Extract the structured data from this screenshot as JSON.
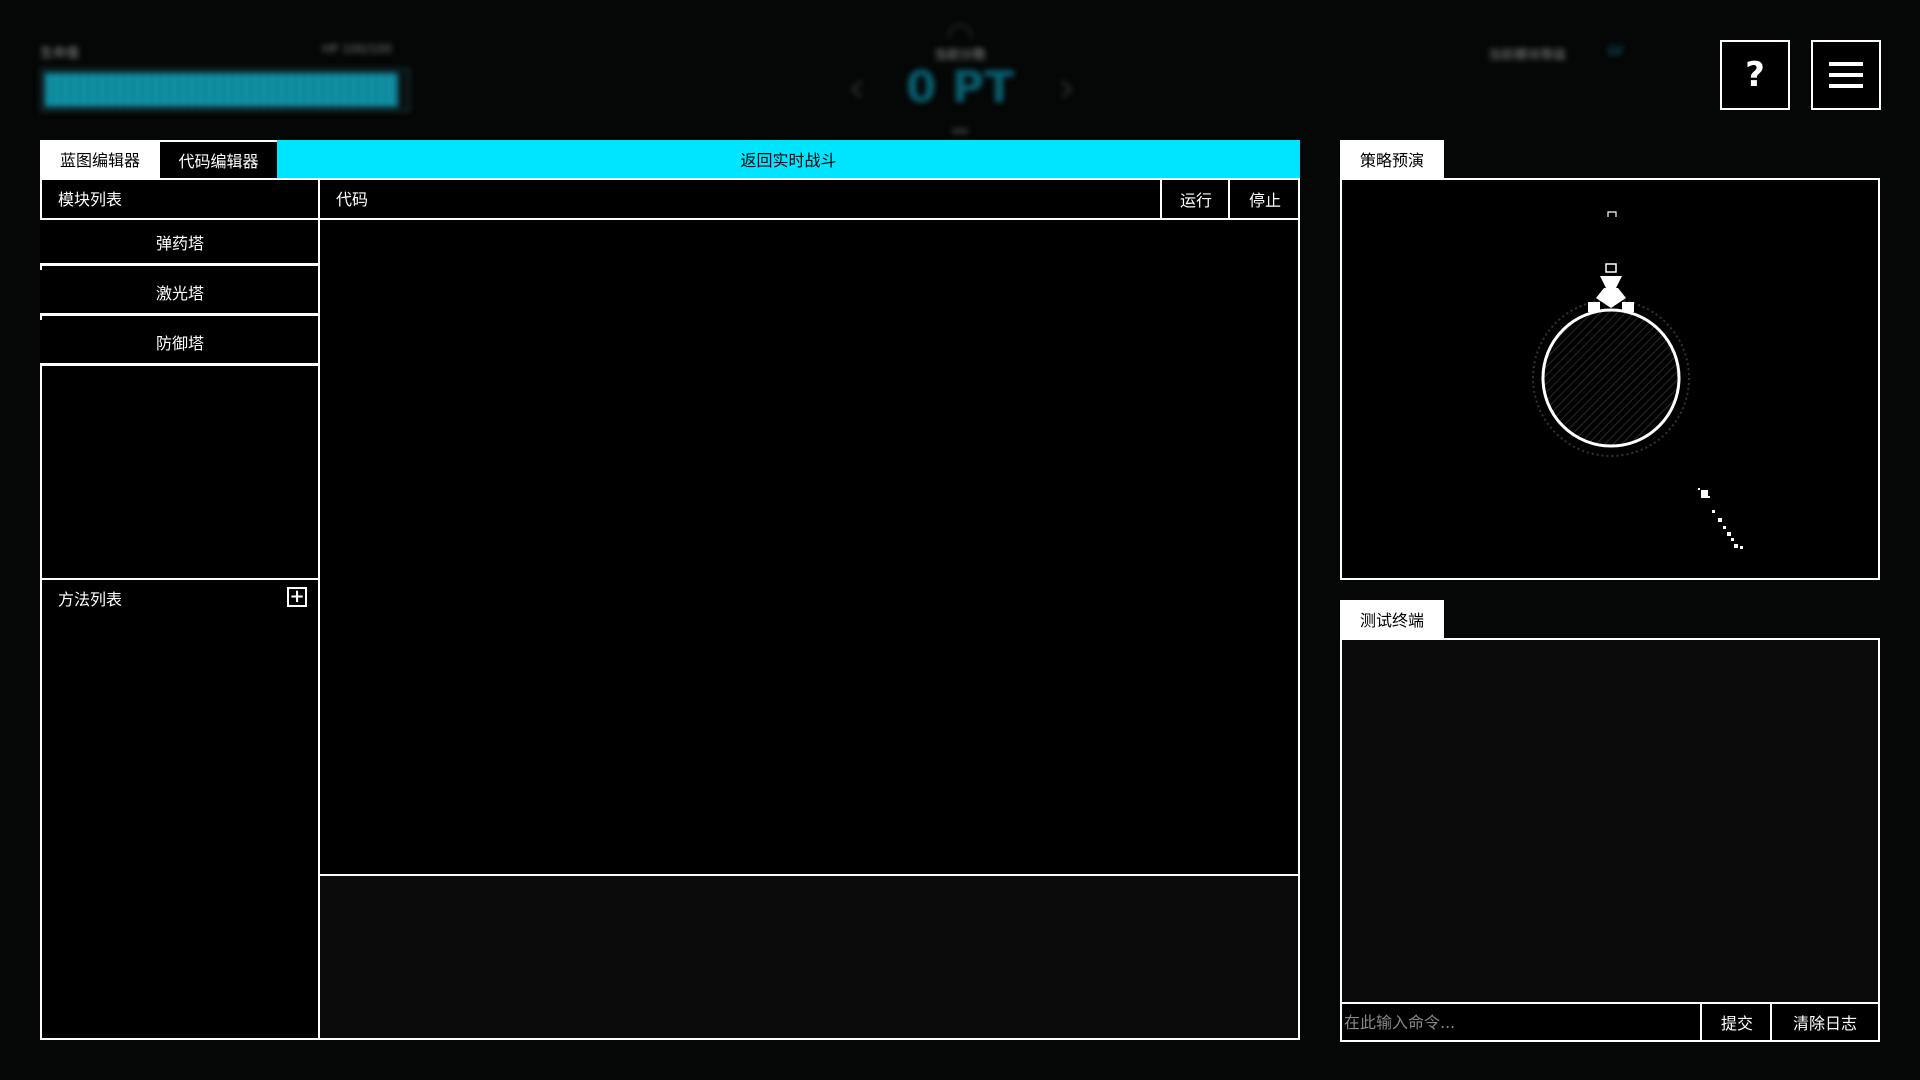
{
  "hud": {
    "hp_label": "生命值",
    "hp_value": "HP 100/100",
    "hp_fill": 0.98,
    "center_label": "当前分数",
    "score": "0 PT",
    "prev_arrow": "‹",
    "next_arrow": "›",
    "right_status": "当前模块等级",
    "right_status_value": "LV",
    "help_label": "?"
  },
  "tabs": {
    "blueprint": "蓝图编辑器",
    "code": "代码编辑器",
    "return": "返回实时战斗"
  },
  "modules": {
    "header": "模块列表",
    "items": [
      "弹药塔",
      "激光塔",
      "防御塔"
    ]
  },
  "methods": {
    "header": "方法列表",
    "add_icon": "plus-icon",
    "add_symbol": "+"
  },
  "code": {
    "header": "代码",
    "run": "运行",
    "stop": "停止"
  },
  "preview": {
    "tab": "策略预演"
  },
  "terminal": {
    "tab": "测试终端",
    "placeholder": "在此输入命令...",
    "submit": "提交",
    "clear": "清除日志"
  },
  "colors": {
    "accent": "#00e5ff",
    "background": "#050606",
    "panel": "#000000",
    "border": "#ffffff"
  }
}
